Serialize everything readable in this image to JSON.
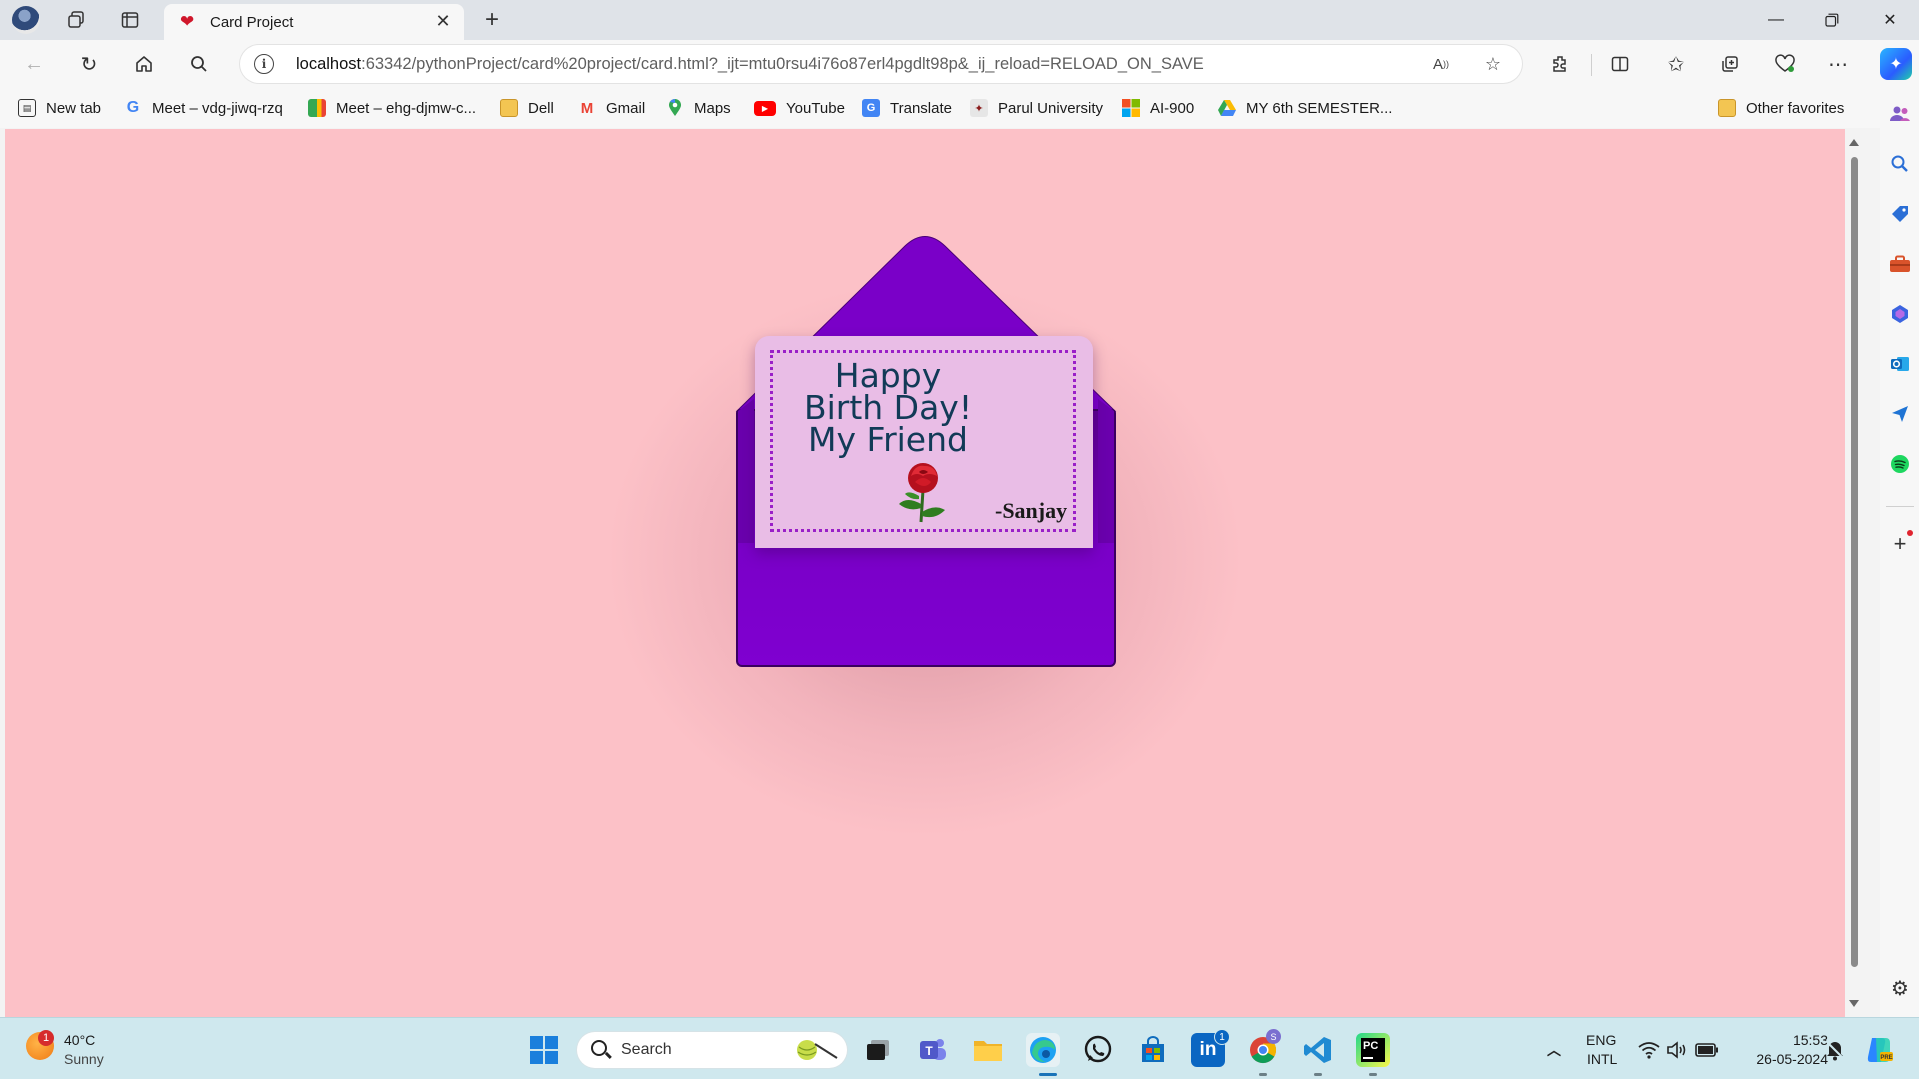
{
  "browser": {
    "tab_title": "Card Project",
    "url_host": "localhost",
    "url_rest": ":63342/pythonProject/card%20project/card.html?_ijt=mtu0rsu4i76o87erl4pgdlt98p&_ij_reload=RELOAD_ON_SAVE"
  },
  "favorites": [
    {
      "label": "New tab",
      "icon": "new-tab-icon"
    },
    {
      "label": "Meet – vdg-jiwq-rzq",
      "icon": "google-icon"
    },
    {
      "label": "Meet – ehg-djmw-c...",
      "icon": "meet-icon"
    },
    {
      "label": "Dell",
      "icon": "folder-icon"
    },
    {
      "label": "Gmail",
      "icon": "gmail-icon"
    },
    {
      "label": "Maps",
      "icon": "maps-icon"
    },
    {
      "label": "YouTube",
      "icon": "youtube-icon"
    },
    {
      "label": "Translate",
      "icon": "translate-icon"
    },
    {
      "label": "Parul University",
      "icon": "university-icon"
    },
    {
      "label": "AI-900",
      "icon": "microsoft-icon"
    },
    {
      "label": "MY 6th SEMESTER...",
      "icon": "drive-icon"
    }
  ],
  "other_favorites": "Other favorites",
  "card": {
    "line1": "Happy",
    "line2": "Birth Day!",
    "line3": "My Friend",
    "signature": "-Sanjay"
  },
  "colors": {
    "page_background": "#fcc1c7",
    "envelope": "#7a00c8",
    "card": "#e9bde6",
    "card_border": "#9a1fc8",
    "message_text": "#123a57"
  },
  "taskbar": {
    "weather_temp": "40°C",
    "weather_desc": "Sunny",
    "weather_badge": "1",
    "search_label": "Search",
    "linkedin_badge": "1",
    "lang_line1": "ENG",
    "lang_line2": "INTL",
    "time": "15:53",
    "date": "26-05-2024"
  }
}
